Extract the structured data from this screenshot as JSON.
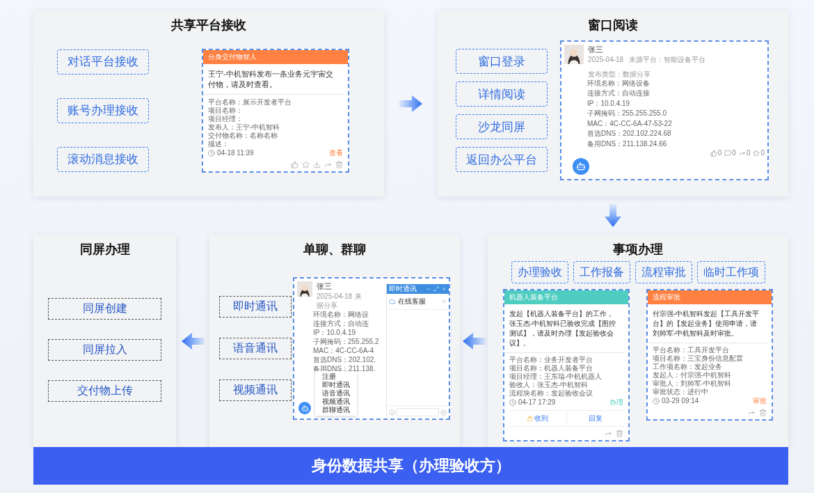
{
  "shared_platform": {
    "title": "共享平台接收",
    "options": [
      "对话平台接收",
      "账号办理接收",
      "滚动消息接收"
    ],
    "notice": {
      "header": "分身交付物智人",
      "message": "王宁-中机智科发布一条业务元宇宙交付物，请及时查看。",
      "fields": [
        "平台名称：展示开发者平台",
        "项目名称：",
        "项目经理：",
        "发布人：王宁-中机智科",
        "交付物名称：名称名称",
        "描述："
      ],
      "time": "04-18 11:39",
      "action": "查看"
    }
  },
  "window_reading": {
    "title": "窗口阅读",
    "options": [
      "窗口登录",
      "详情阅读",
      "沙龙同屏",
      "返回办公平台"
    ],
    "post": {
      "author": "张三",
      "date": "2025-04-18",
      "source": "来源平台：智能设备平台",
      "type": "发布类型：数据分享",
      "fields": [
        "环境名称：网络设备",
        "连接方式：自动连接",
        "IP：10.0.4.19",
        "子网掩码：255.255.255.0",
        "MAC：4C-CC-6A-47-53-22",
        "首选DNS：202.102.224.68",
        "备用DNS：211.138.24.66"
      ],
      "stats": [
        {
          "kind": "like",
          "count": "0"
        },
        {
          "kind": "comment",
          "count": "0"
        },
        {
          "kind": "share",
          "count": "0"
        },
        {
          "kind": "favorite",
          "count": "0"
        }
      ]
    }
  },
  "matters": {
    "title": "事项办理",
    "options": [
      "办理验收",
      "工作报备",
      "流程审批",
      "临时工作项"
    ],
    "cards": [
      {
        "header": "机器人装备平台",
        "color": "#4ecdc0",
        "message": "发起【机器人装备平台】的工作，张玉杰-中机智科已验收完成【图控测试】，请及时办理【发起验收会议】。",
        "fields": [
          "平台名称：业务开发者平台",
          "项目名称：机器人装备平台",
          "项目经理：王东瑞-中机机器人",
          "验收人：张玉杰-中机智科",
          "流程块名称：发起验收会议"
        ],
        "time": "04-17 17:29",
        "action": "办理",
        "buttons": [
          "收到",
          "回复"
        ]
      },
      {
        "header": "流程审批",
        "color": "#ff8040",
        "message": "付宗强-中机智科发起【工具开发平台】的【发起业务】使用申请，请刘帅军-中机智科及时审批。",
        "fields": [
          "平台名称：工具开发平台",
          "项目名称：三宝身份信息配置",
          "工作项名称：发起业务",
          "发起人：付宗强-中机智科",
          "审批人：刘帅军-中机智科",
          "审批状态：进行中"
        ],
        "time": "03-29 09:14",
        "action": "审批"
      }
    ]
  },
  "chat": {
    "title": "单聊、群聊",
    "options": [
      "即时通讯",
      "语音通讯",
      "视频通讯"
    ],
    "preview": {
      "author": "张三",
      "date": "2025-04-18",
      "source": "来",
      "type": "据分享",
      "fields": [
        "环境名称：网络设",
        "连接方式：自动连",
        "IP：10.0.4.19",
        "子网掩码：255.255.2",
        "MAC：4C-CC-6A-4",
        "首选DNS：202.102.",
        "备用DNS：211.138."
      ]
    },
    "window": {
      "title": "即时通讯",
      "contact": "在线客服"
    },
    "menu": [
      "注册",
      "即时通讯",
      "语音通讯",
      "视频通讯",
      "群聊通讯"
    ]
  },
  "same_screen": {
    "title": "同屏办理",
    "options": [
      "同屏创建",
      "同屏拉入",
      "交付物上传"
    ]
  },
  "banner": "身份数据共享（办理验收方）"
}
